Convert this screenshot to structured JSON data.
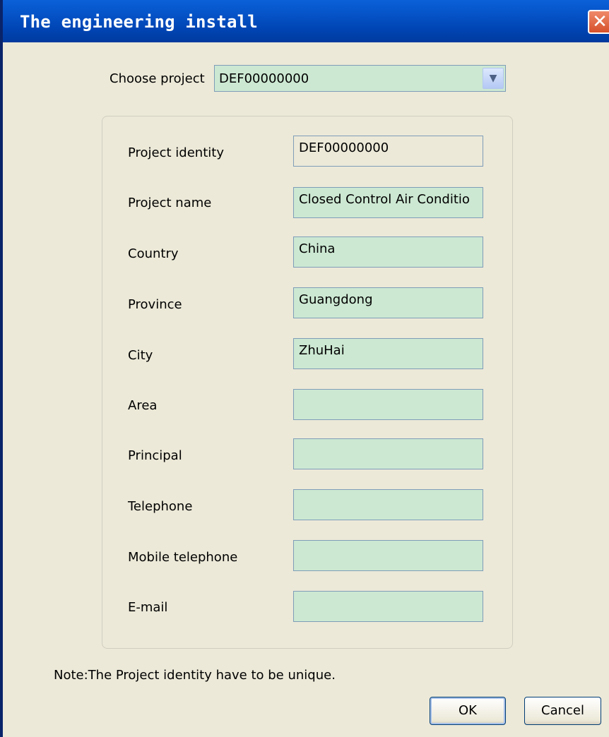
{
  "window": {
    "title": "The engineering install",
    "close_glyph": "✕"
  },
  "project_selector": {
    "label": "Choose project",
    "selected": "DEF00000000",
    "arrow_glyph": "▼"
  },
  "fields": [
    {
      "label": "Project identity",
      "value": "DEF00000000",
      "readonly": true
    },
    {
      "label": "Project name",
      "value": "Closed Control Air Conditio"
    },
    {
      "label": "Country",
      "value": "China"
    },
    {
      "label": "Province",
      "value": "Guangdong"
    },
    {
      "label": "City",
      "value": "ZhuHai"
    },
    {
      "label": "Area",
      "value": ""
    },
    {
      "label": "Principal",
      "value": ""
    },
    {
      "label": "Telephone",
      "value": ""
    },
    {
      "label": "Mobile telephone",
      "value": ""
    },
    {
      "label": "E-mail",
      "value": ""
    }
  ],
  "note": "Note:The Project identity have to be unique.",
  "buttons": {
    "ok": "OK",
    "cancel": "Cancel"
  },
  "colors": {
    "titlebar": "#0553c7",
    "input_bg": "#cce8d2",
    "window_bg": "#ece9d8"
  }
}
